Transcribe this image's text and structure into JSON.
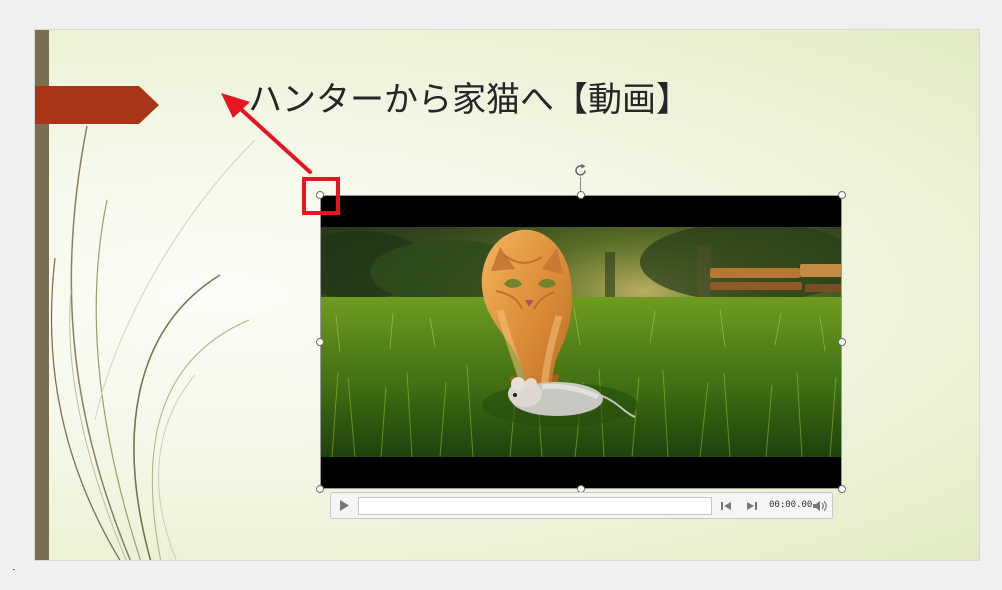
{
  "slide": {
    "title": "ハンターから家猫へ【動画】",
    "accent_color": "#a93519",
    "band_color": "#7b6f52"
  },
  "annotation": {
    "arrow_color": "#e8141f",
    "highlight": "top-left-resize-handle"
  },
  "video": {
    "content": "orange kitten stalking a toy mouse in grass"
  },
  "player": {
    "time": "00:00.00",
    "progress": 0,
    "icons": {
      "play": "play-icon",
      "back": "step-back-icon",
      "forward": "step-forward-icon",
      "volume": "volume-icon"
    }
  }
}
